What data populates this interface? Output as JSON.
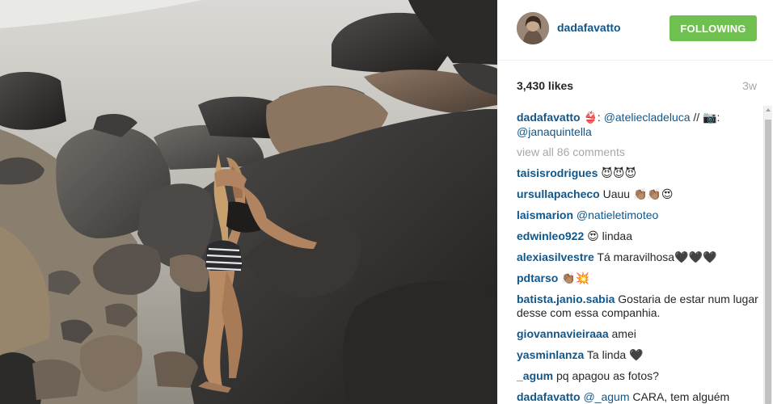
{
  "post": {
    "image": "beach-rocks-photo",
    "header": {
      "username": "dadafavatto",
      "follow_label": "FOLLOWING",
      "follow_color": "#70c050"
    },
    "likes": "3,430 likes",
    "time_ago": "3w",
    "caption": {
      "user": "dadafavatto",
      "emoji_1": "👙",
      "sep_1": ":",
      "mention_1": "@ateliecladeluca",
      "sep_2": "//",
      "emoji_2": "📷",
      "sep_3": ":",
      "mention_2": "@janaquintella"
    },
    "view_all": "view all 86 comments",
    "comments": [
      {
        "user": "taisisrodrigues",
        "text": "😈😈😈"
      },
      {
        "user": "ursullapacheco",
        "text": "Uauu 👏🏽👏🏽😍"
      },
      {
        "user": "laismarion",
        "mention": "@natieletimoteo"
      },
      {
        "user": "edwinleo922",
        "text": "😍 lindaa"
      },
      {
        "user": "alexiasilvestre",
        "text": "Tá maravilhosa🖤🖤🖤"
      },
      {
        "user": "pdtarso",
        "text": "👏🏽💥"
      },
      {
        "user": "batista.janio.sabia",
        "text": "Gostaria de estar num lugar desse com essa companhia."
      },
      {
        "user": "giovannavieiraaa",
        "text": "amei"
      },
      {
        "user": "yasminlanza",
        "text": "Ta linda 🖤"
      },
      {
        "user": "_agum",
        "text": "pq apagou as fotos?"
      },
      {
        "user": "dadafavatto",
        "mention": "@_agum",
        "text": "CARA, tem alguém"
      }
    ],
    "colors": {
      "link": "#125688",
      "muted": "#a5a7aa",
      "text": "#262626"
    }
  }
}
